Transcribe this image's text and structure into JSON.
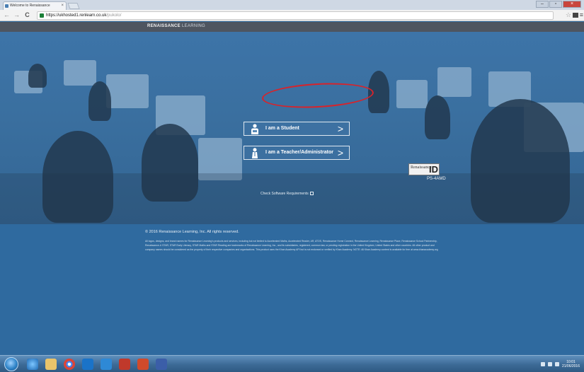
{
  "browser": {
    "tab_title": "Welcome to Renaissance",
    "tab_close": "×",
    "url_host": "https://ukhosted1.renlearn.co.uk",
    "url_path": "/pukolo/",
    "back": "←",
    "forward": "→",
    "reload": "C",
    "bookmark": "☆",
    "menu": "≡",
    "win_min": "–",
    "win_max": "▫",
    "win_close": "×"
  },
  "header": {
    "brand_bold": "RENAISSANCE",
    "brand_light": " LEARNING"
  },
  "login": {
    "student_label": "I am a Student",
    "teacher_label": "I am a Teacher/Administrator",
    "chevron": ">"
  },
  "renaissance_id": {
    "logo_text": "Renaissance",
    "logo_suffix": "ID",
    "code": "PS-4AMD"
  },
  "links": {
    "check_requirements": "Check Software Requirements"
  },
  "footer": {
    "copyright": "© 2016 Renaissance Learning, Inc. All rights reserved.",
    "legal": "All logos, designs, and brand names for Renaissance Learning's products and services, including but not limited to Accelerated Maths, Accelerated Reader, AR, ATOS, Renaissance Home Connect, Renaissance Learning, Renaissance Place, Renaissance School Partnership, Renaissance-U STAR, STAR Early Literacy, STAR Maths and STAR Reading are trademarks of Renaissance Learning, Inc., and its subsidiaries, registered, common law, or pending registration in the United Kingdom, United States and other countries. All other product and company names should be considered as the property of their respective companies and organisations. This product uses the Khan Academy API but is not endorsed or verified by Khan Academy. NOTE: All Khan Academy content is available for free at www.khanacademy.org"
  },
  "taskbar": {
    "time": "10:01",
    "date": "21/06/2016"
  },
  "colors": {
    "hero_blue": "#3a6f9f",
    "footer_blue": "#2f6a9f",
    "annotation_red": "#d8232a"
  }
}
